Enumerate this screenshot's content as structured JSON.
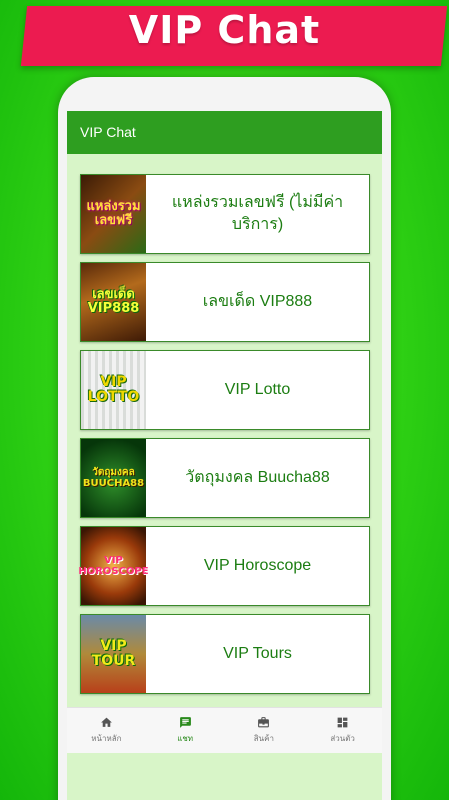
{
  "banner": {
    "title": "VIP Chat"
  },
  "appbar": {
    "title": "VIP Chat"
  },
  "items": [
    {
      "label": "แหล่งรวมเลขฟรี (ไม่มีค่าบริการ)",
      "thumb_text": [
        "แหล่งรวม",
        "เลขฟรี"
      ]
    },
    {
      "label": "เลขเด็ด VIP888",
      "thumb_text": [
        "เลขเด็ด",
        "VIP888"
      ]
    },
    {
      "label": "VIP Lotto",
      "thumb_text": [
        "VIP",
        "LOTTO"
      ]
    },
    {
      "label": "วัตถุมงคล Buucha88",
      "thumb_text": [
        "วัตถุมงคล",
        "BUUCHA88"
      ]
    },
    {
      "label": "VIP Horoscope",
      "thumb_text": [
        "VIP",
        "HOROSCOPE"
      ]
    },
    {
      "label": "VIP Tours",
      "thumb_text": [
        "VIP",
        "TOUR"
      ]
    }
  ],
  "bottom_nav": [
    {
      "label": "หน้าหลัก",
      "icon": "home-icon"
    },
    {
      "label": "แชท",
      "icon": "chat-icon",
      "active": true
    },
    {
      "label": "สินค้า",
      "icon": "briefcase-icon"
    },
    {
      "label": "ส่วนตัว",
      "icon": "dashboard-icon"
    }
  ],
  "colors": {
    "accent": "#2e9e20",
    "banner": "#ec1b50",
    "item_text": "#1c7d12"
  }
}
